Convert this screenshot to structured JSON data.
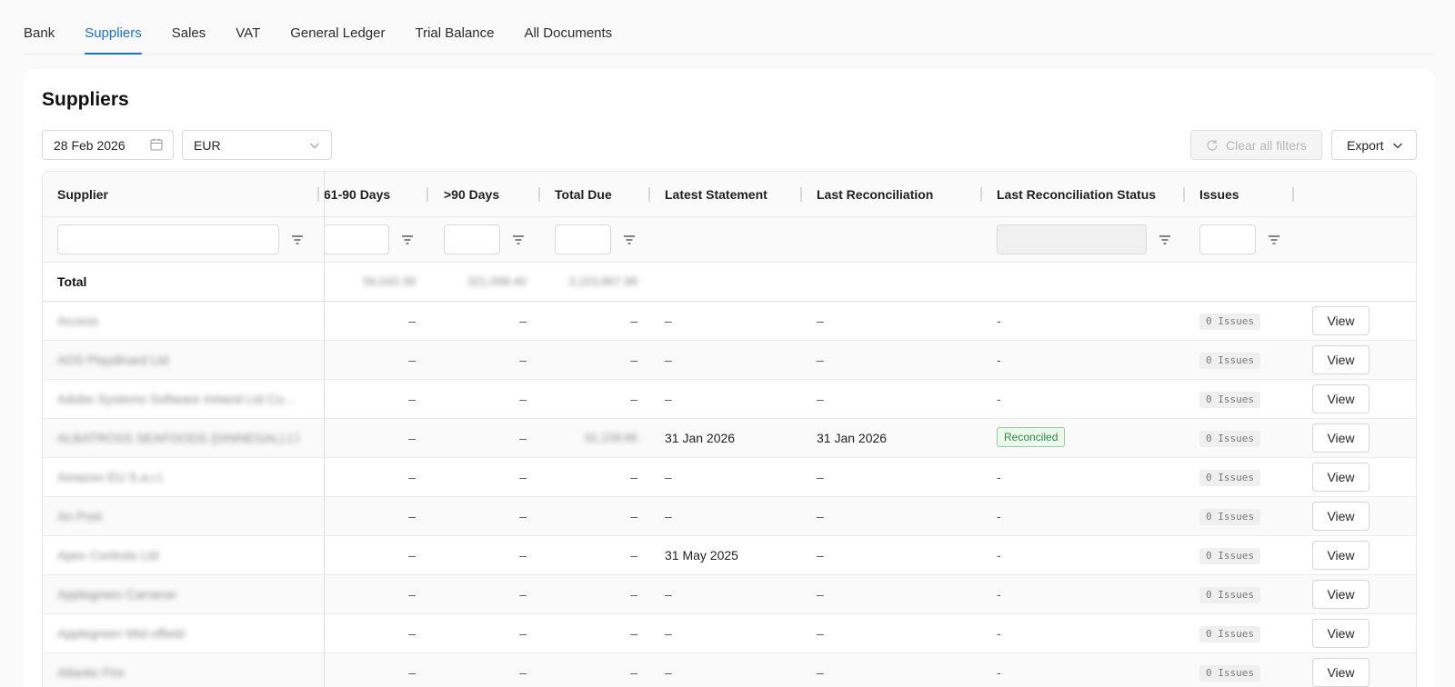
{
  "nav": {
    "tabs": [
      {
        "label": "Bank",
        "active": false
      },
      {
        "label": "Suppliers",
        "active": true
      },
      {
        "label": "Sales",
        "active": false
      },
      {
        "label": "VAT",
        "active": false
      },
      {
        "label": "General Ledger",
        "active": false
      },
      {
        "label": "Trial Balance",
        "active": false
      },
      {
        "label": "All Documents",
        "active": false
      }
    ]
  },
  "page": {
    "title": "Suppliers",
    "date_filter": "28 Feb 2026",
    "currency": "EUR",
    "clear_filters_label": "Clear all filters",
    "export_label": "Export"
  },
  "table": {
    "columns": {
      "supplier": "Supplier",
      "d61_90": "61-90 Days",
      "d90": ">90 Days",
      "total_due": "Total Due",
      "latest_statement": "Latest Statement",
      "last_reconciliation": "Last Reconciliation",
      "last_status": "Last Reconciliation Status",
      "issues": "Issues"
    },
    "total": {
      "label": "Total",
      "d61_90": "56,043.39",
      "d90": "321,099.40",
      "total_due": "3,153,867.98"
    },
    "rows": [
      {
        "supplier": "Access",
        "d61_90": "–",
        "d90": "–",
        "total_due": "–",
        "latest_statement": "–",
        "last_reconciliation": "–",
        "status": "-",
        "issues": "0 Issues",
        "action": "View"
      },
      {
        "supplier": "ADS Playdinard Ltd",
        "d61_90": "–",
        "d90": "–",
        "total_due": "–",
        "latest_statement": "–",
        "last_reconciliation": "–",
        "status": "-",
        "issues": "0 Issues",
        "action": "View"
      },
      {
        "supplier": "Adobe Systems Software Ireland Ltd Co...",
        "d61_90": "–",
        "d90": "–",
        "total_due": "–",
        "latest_statement": "–",
        "last_reconciliation": "–",
        "status": "-",
        "issues": "0 Issues",
        "action": "View"
      },
      {
        "supplier": "ALBATROSS SEAFOODS (DINNEGAL) LTD",
        "d61_90": "–",
        "d90": "–",
        "total_due": "91,158.86",
        "latest_statement": "31 Jan 2026",
        "last_reconciliation": "31 Jan 2026",
        "status": "Reconciled",
        "issues": "0 Issues",
        "action": "View"
      },
      {
        "supplier": "Amazon EU S.a.r.l.",
        "d61_90": "–",
        "d90": "–",
        "total_due": "–",
        "latest_statement": "–",
        "last_reconciliation": "–",
        "status": "-",
        "issues": "0 Issues",
        "action": "View"
      },
      {
        "supplier": "An Post",
        "d61_90": "–",
        "d90": "–",
        "total_due": "–",
        "latest_statement": "–",
        "last_reconciliation": "–",
        "status": "-",
        "issues": "0 Issues",
        "action": "View"
      },
      {
        "supplier": "Apex Controls Ltd",
        "d61_90": "–",
        "d90": "–",
        "total_due": "–",
        "latest_statement": "31 May 2025",
        "last_reconciliation": "–",
        "status": "-",
        "issues": "0 Issues",
        "action": "View"
      },
      {
        "supplier": "Applegreen Carraroe",
        "d61_90": "–",
        "d90": "–",
        "total_due": "–",
        "latest_statement": "–",
        "last_reconciliation": "–",
        "status": "-",
        "issues": "0 Issues",
        "action": "View"
      },
      {
        "supplier": "Applegreen Mid-offield",
        "d61_90": "–",
        "d90": "–",
        "total_due": "–",
        "latest_statement": "–",
        "last_reconciliation": "–",
        "status": "-",
        "issues": "0 Issues",
        "action": "View"
      },
      {
        "supplier": "Atlantic Fire",
        "d61_90": "–",
        "d90": "–",
        "total_due": "–",
        "latest_statement": "–",
        "last_reconciliation": "–",
        "status": "-",
        "issues": "0 Issues",
        "action": "View"
      }
    ]
  },
  "icons": {
    "calendar": "calendar-icon",
    "chevron": "chevron-down-icon",
    "refresh": "refresh-icon",
    "filter": "filter-icon"
  },
  "colors": {
    "accent": "#1a6fe0",
    "reconciled": "#2a8a3e"
  }
}
